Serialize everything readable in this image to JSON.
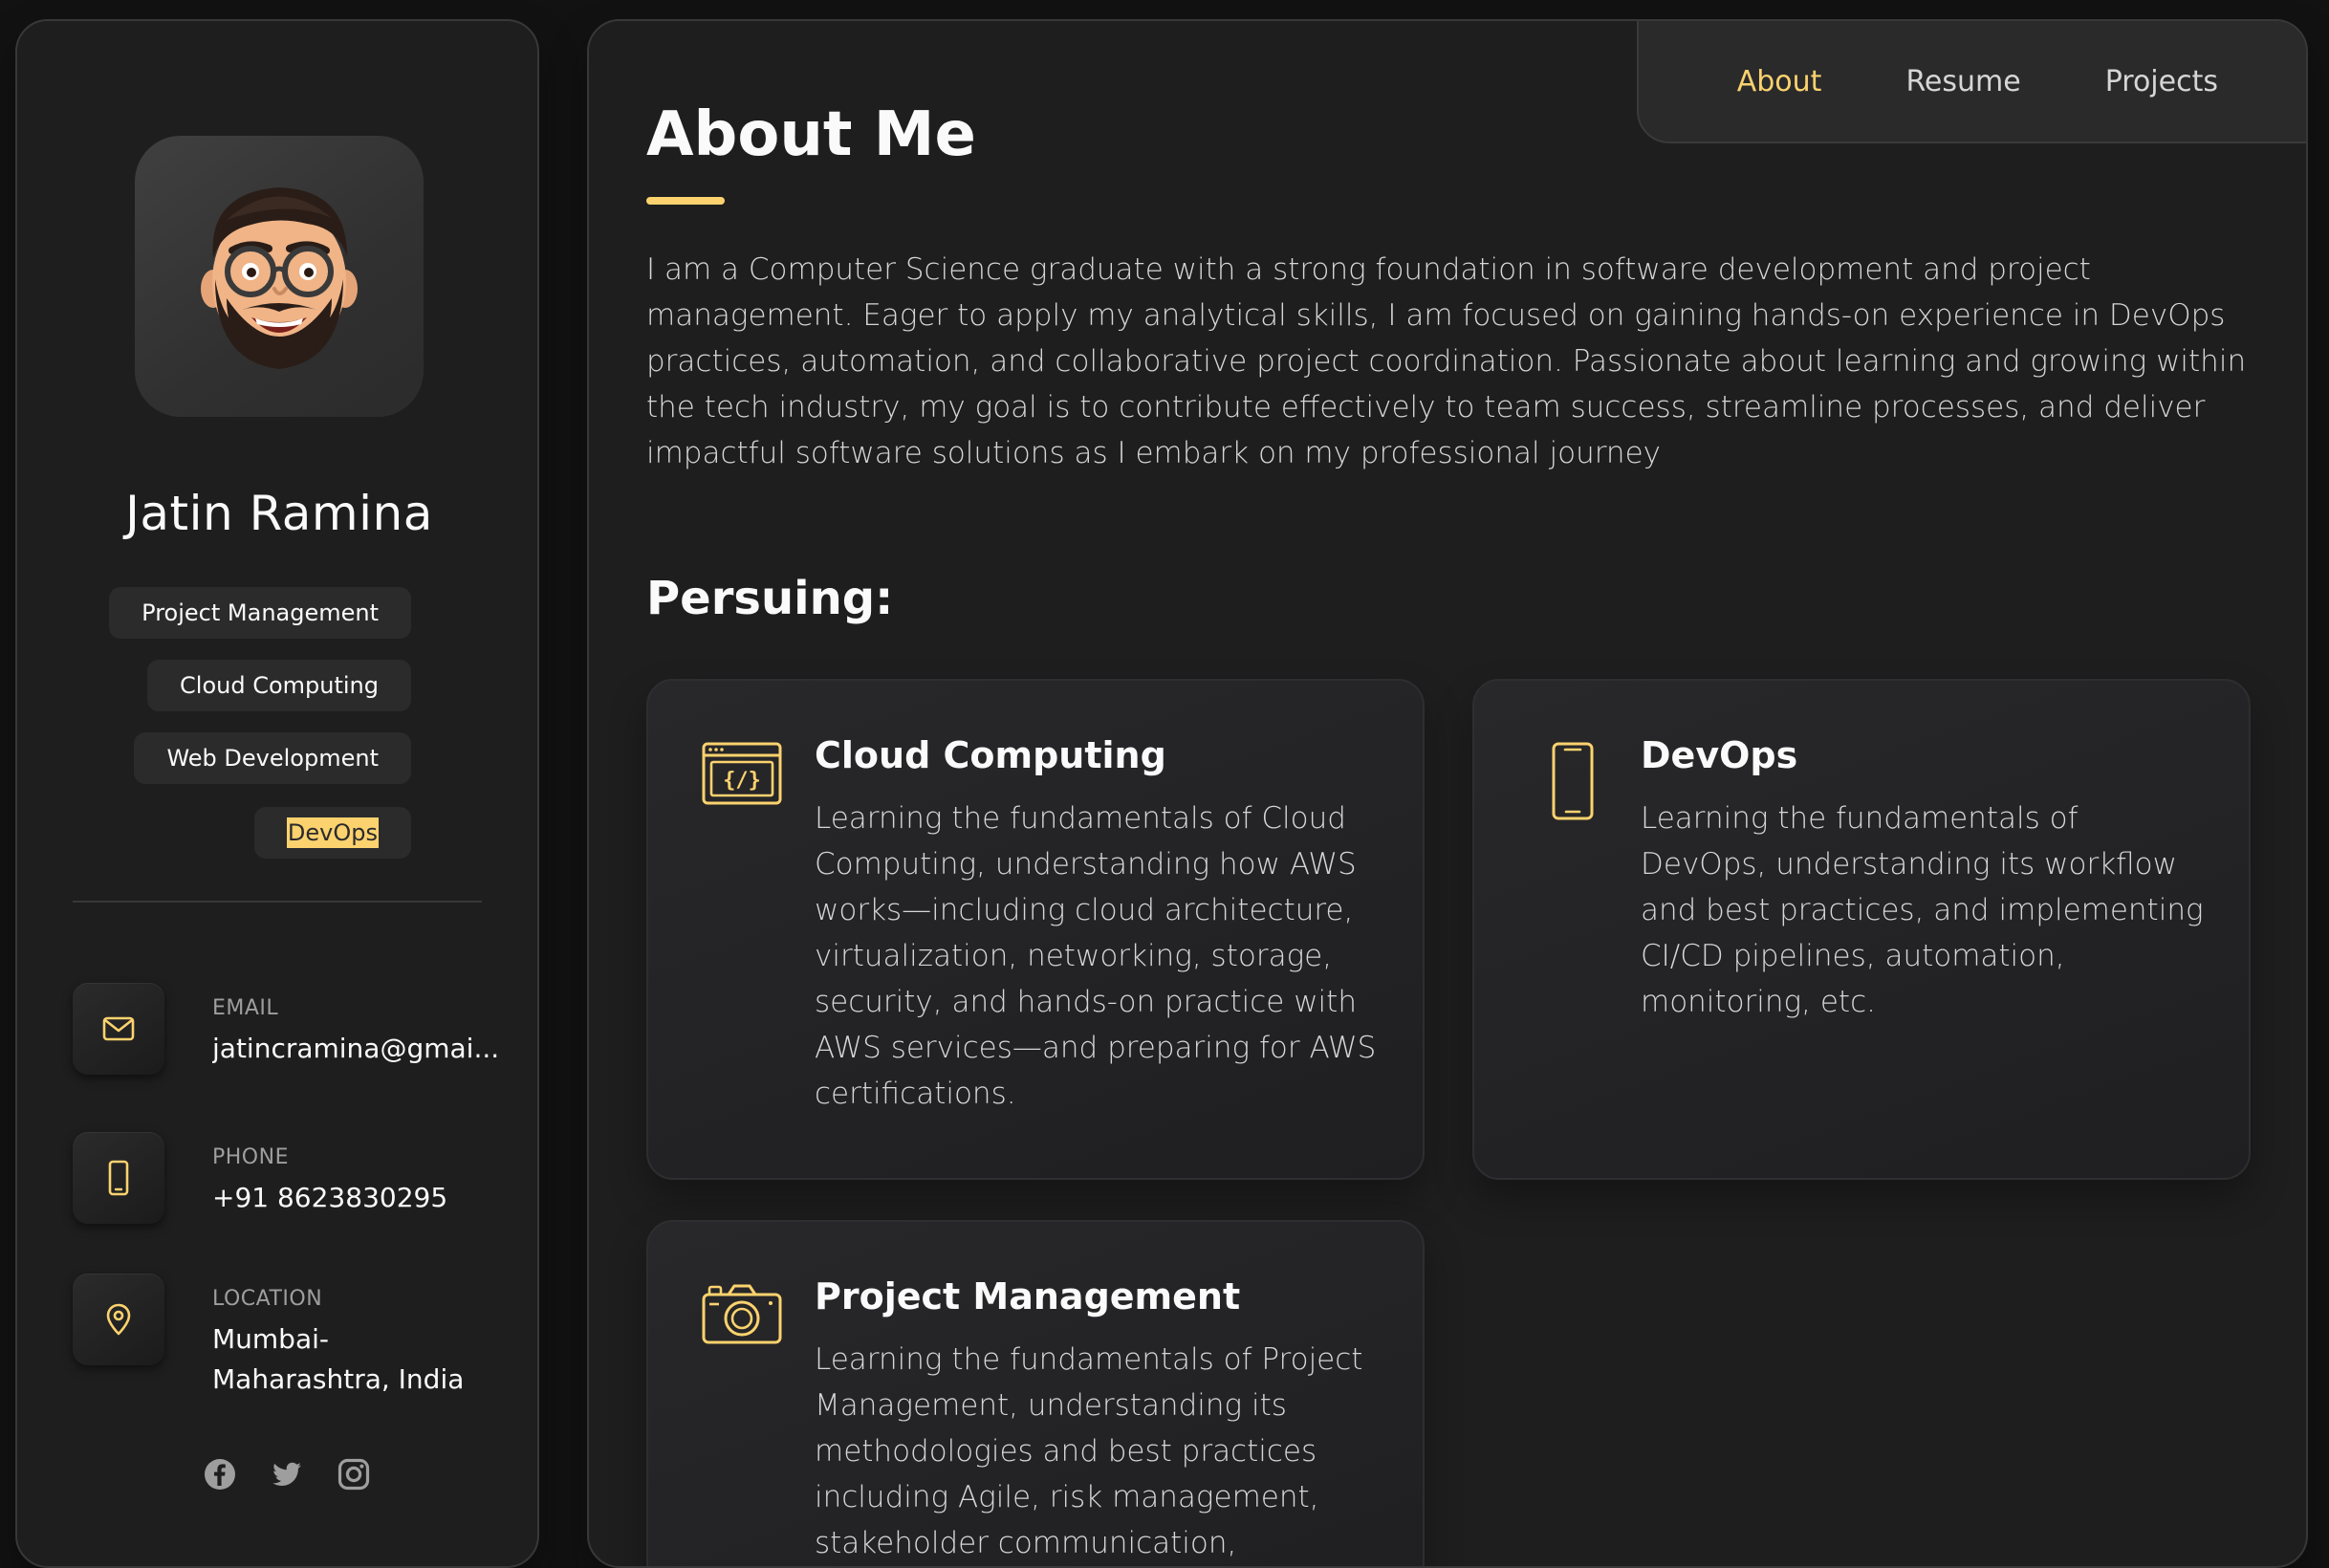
{
  "profile": {
    "name": "Jatin Ramina",
    "avatar_icon": "memoji-avatar",
    "tags": [
      "Project Management",
      "Cloud Computing",
      "Web Development",
      "DevOps"
    ],
    "contacts": [
      {
        "label": "EMAIL",
        "value": "jatincramina@gmai...",
        "icon": "mail-icon"
      },
      {
        "label": "PHONE",
        "value": "+91 8623830295",
        "icon": "phone-icon"
      },
      {
        "label": "LOCATION",
        "value": "Mumbai-Maharashtra, India",
        "icon": "location-pin-icon"
      }
    ],
    "socials": [
      "facebook-icon",
      "twitter-icon",
      "instagram-icon"
    ]
  },
  "nav": {
    "links": [
      "About",
      "Resume",
      "Projects"
    ],
    "active": "About"
  },
  "about": {
    "title": "About Me",
    "text": "I am a Computer Science graduate with a strong foundation in software development and project management. Eager to apply my analytical skills, I am focused on gaining hands-on experience in DevOps practices, automation, and collaborative project coordination. Passionate about learning and growing within the tech industry, my goal is to contribute effectively to team success, streamline processes, and deliver impactful software solutions as I embark on my professional journey"
  },
  "pursuing": {
    "title": "Persuing:",
    "cards": [
      {
        "title": "Cloud Computing",
        "icon": "code-window-icon",
        "text": "Learning the fundamentals of Cloud Computing, understanding how AWS works—including cloud architecture, virtualization, networking, storage, security, and hands-on practice with AWS services—and preparing for AWS certifications."
      },
      {
        "title": "DevOps",
        "icon": "smartphone-icon",
        "text": "Learning the fundamentals of DevOps, understanding its workflow and best practices, and implementing CI/CD pipelines, automation, monitoring, etc."
      },
      {
        "title": "Project Management",
        "icon": "camera-icon",
        "text": "Learning the fundamentals of Project Management, understanding its methodologies and best practices including Agile, risk management, stakeholder communication,"
      }
    ]
  },
  "colors": {
    "accent": "#fbd26e",
    "background": "#121212",
    "panel": "#1e1e1f",
    "chip": "#2b2b2c",
    "text": "#fafafa",
    "muted_text": "#d6d6d6"
  }
}
